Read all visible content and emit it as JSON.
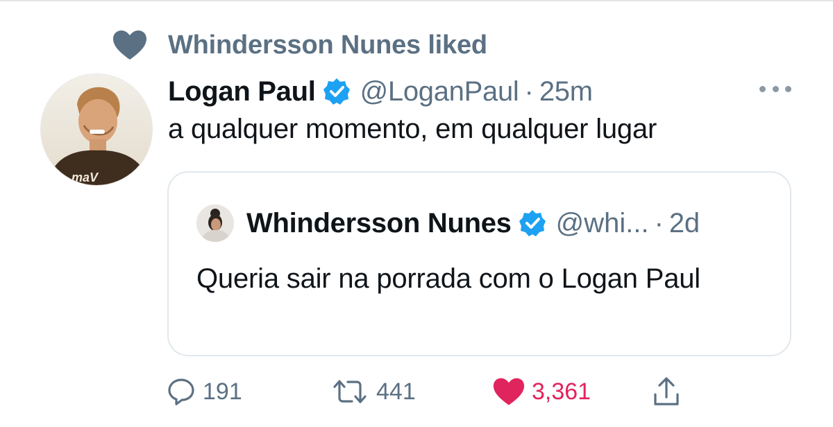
{
  "social_context": {
    "text": "Whindersson Nunes liked",
    "icon": "heart-icon"
  },
  "tweet": {
    "display_name": "Logan Paul",
    "handle": "@LoganPaul",
    "separator": "·",
    "time": "25m",
    "text": "a qualquer momento, em qualquer lugar",
    "avatar_logo_text": "maV"
  },
  "quoted_tweet": {
    "display_name": "Whindersson Nunes",
    "handle": "@whi...",
    "separator": "·",
    "time": "2d",
    "text": "Queria sair na porrada com o Logan Paul"
  },
  "actions": {
    "replies": "191",
    "retweets": "441",
    "likes": "3,361"
  },
  "colors": {
    "text_primary": "#0f1419",
    "text_secondary": "#5b7083",
    "verified_blue": "#1da1f2",
    "like_pink": "#e0245e",
    "border": "#e1e8ed"
  }
}
